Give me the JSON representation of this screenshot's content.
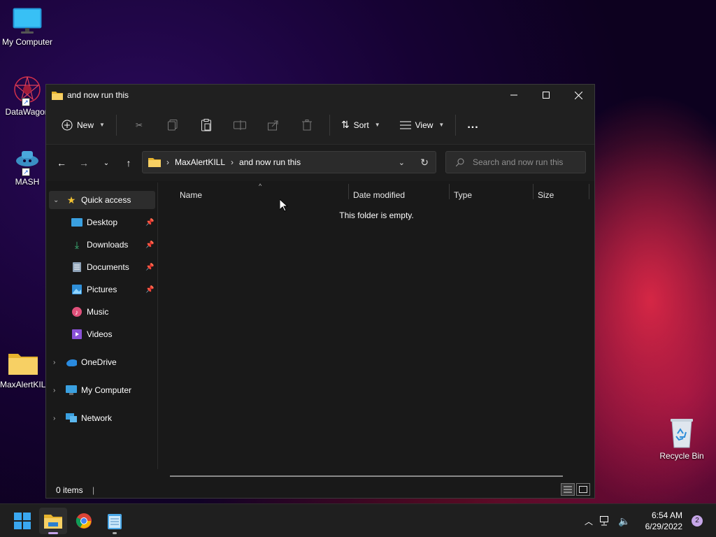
{
  "desktop": {
    "icons": [
      {
        "label": "My Computer"
      },
      {
        "label": "DataWagon"
      },
      {
        "label": "MASH"
      },
      {
        "label": "MaxAlertKILL"
      },
      {
        "label": "Recycle Bin"
      }
    ]
  },
  "window": {
    "title": "and now run this",
    "toolbar": {
      "new_label": "New",
      "sort_label": "Sort",
      "view_label": "View",
      "more_label": "..."
    },
    "address": {
      "crumbs": [
        "MaxAlertKILL",
        "and now run this"
      ]
    },
    "search": {
      "placeholder": "Search and now run this"
    },
    "sidebar": {
      "quick_access": "Quick access",
      "pinned": [
        "Desktop",
        "Downloads",
        "Documents",
        "Pictures"
      ],
      "other": [
        "Music",
        "Videos"
      ],
      "roots": [
        "OneDrive",
        "My Computer",
        "Network"
      ]
    },
    "columns": [
      "Name",
      "Date modified",
      "Type",
      "Size"
    ],
    "empty_message": "This folder is empty.",
    "status": "0 items"
  },
  "taskbar": {
    "time": "6:54 AM",
    "date": "6/29/2022",
    "notification_count": "2"
  },
  "colors": {
    "accent": "#0078d4",
    "folder": "#f4c84a",
    "window_bg": "#191919"
  }
}
